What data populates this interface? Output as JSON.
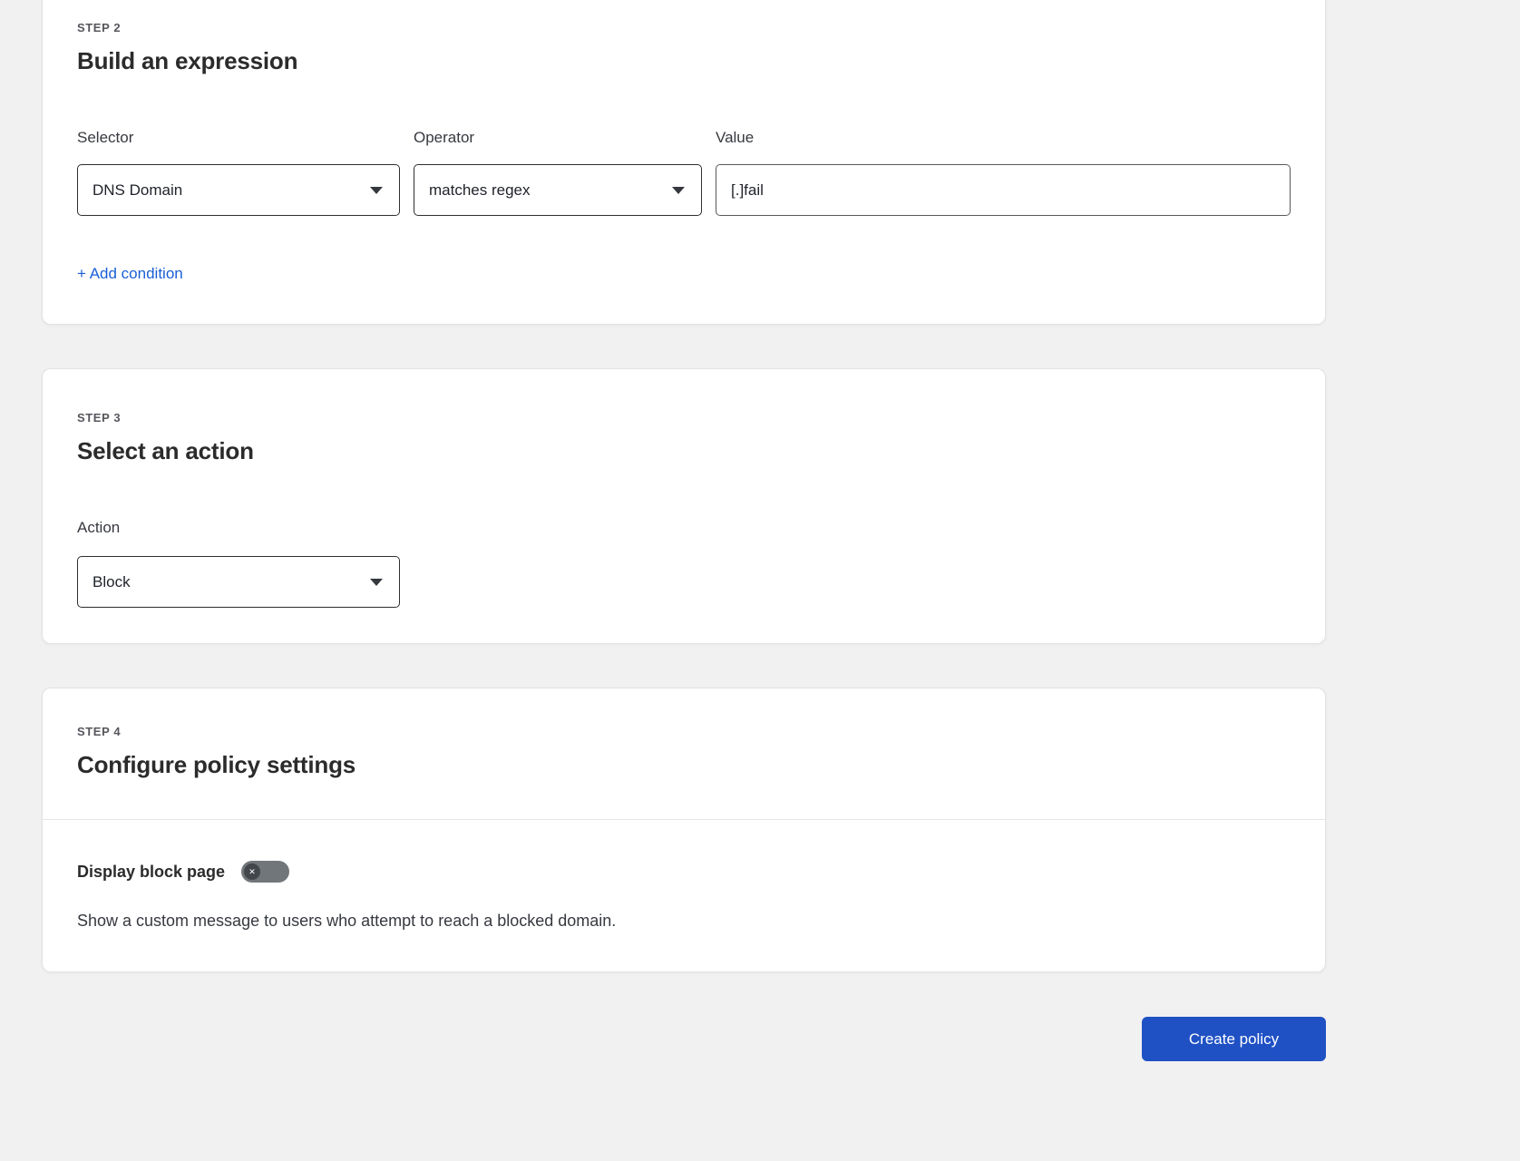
{
  "colors": {
    "page_bg": "#f1f1f1",
    "card_bg": "#ffffff",
    "card_border": "#e3e3e3",
    "divider": "#e5e5e5",
    "link_blue": "#1a5fd7",
    "button_blue": "#1f51c5",
    "heading_text": "#2b2b2b",
    "body_text": "#36393f",
    "muted_text": "#56565c",
    "control_border": "#2e2e2e",
    "toggle_track": "#71767b",
    "toggle_knob": "#43474b"
  },
  "steps": {
    "expression": {
      "step_label": "STEP 2",
      "title": "Build an expression",
      "selector": {
        "label": "Selector",
        "value": "DNS Domain"
      },
      "operator": {
        "label": "Operator",
        "value": "matches regex"
      },
      "value": {
        "label": "Value",
        "value": "[.]fail"
      },
      "add_condition_label": "+ Add condition"
    },
    "action": {
      "step_label": "STEP 3",
      "title": "Select an action",
      "action": {
        "label": "Action",
        "value": "Block"
      }
    },
    "settings": {
      "step_label": "STEP 4",
      "title": "Configure policy settings",
      "toggle": {
        "label": "Display block page",
        "state": "off"
      },
      "description": "Show a custom message to users who attempt to reach a blocked domain."
    }
  },
  "footer": {
    "create_button_label": "Create policy"
  }
}
